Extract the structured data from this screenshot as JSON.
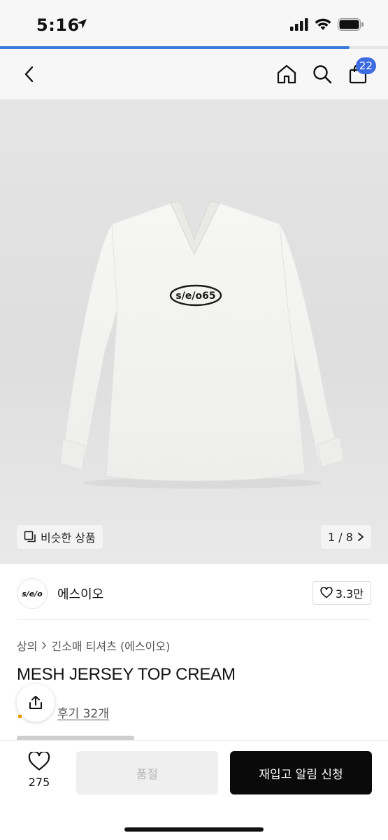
{
  "status_bar": {
    "time": "5:16",
    "progress_fraction": 0.9
  },
  "nav": {
    "back_icon": "chevron-left-icon",
    "home_icon": "home-icon",
    "search_icon": "search-icon",
    "cart_icon": "shopping-bag-icon",
    "cart_count": "22"
  },
  "gallery": {
    "similar_label": "비슷한 상품",
    "current": "1",
    "total": "8",
    "page_indicator": "1 / 8",
    "logo_text": "s/e/o65"
  },
  "brand": {
    "logo_text": "s/e/o",
    "name": "에스이오",
    "likes": "3.3만"
  },
  "product": {
    "breadcrumb": [
      "상의",
      "긴소매 티셔츠 (에스이오)"
    ],
    "title": "MESH JERSEY TOP CREAM",
    "review_text": "후기 32개"
  },
  "bottom_bar": {
    "wish_count": "275",
    "soldout_label": "품절",
    "restock_label": "재입고 알림 신청"
  },
  "colors": {
    "accent": "#3d6be0",
    "progress": "#3b7bd9",
    "primary_button": "#0a0a0a",
    "disabled_button": "#efefef"
  }
}
